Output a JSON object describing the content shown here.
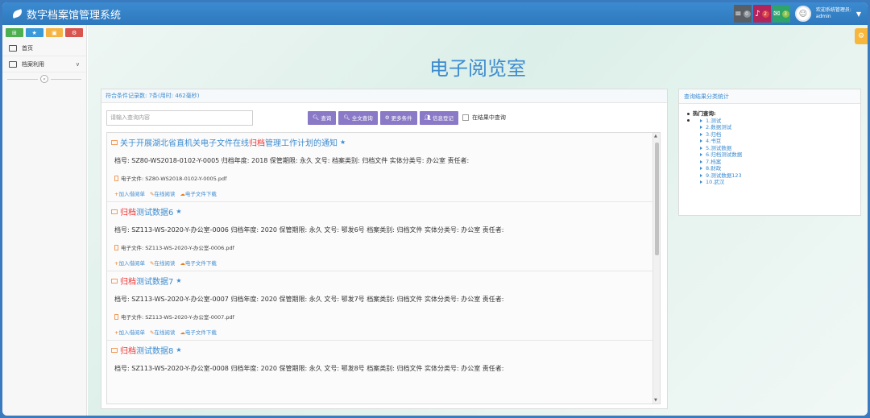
{
  "app": {
    "title": "数字档案馆管理系统"
  },
  "header": {
    "buttons": [
      {
        "icon": "list-icon",
        "count": "0",
        "bg": "#5a5f66",
        "badge": "#8f969e"
      },
      {
        "icon": "bell-icon",
        "count": "2",
        "bg": "#b3245b",
        "badge": "#e04848"
      },
      {
        "icon": "envelope-icon",
        "count": "3",
        "bg": "#2ea36a",
        "badge": "#8bc34a"
      }
    ],
    "user_greeting": "欢迎系统管理员:",
    "user_name": "admin"
  },
  "sidebar": {
    "shortcuts": [
      {
        "icon": "cart-icon",
        "color": "#4caf50"
      },
      {
        "icon": "star-icon",
        "color": "#3a9ad9"
      },
      {
        "icon": "bag-icon",
        "color": "#f4b342"
      },
      {
        "icon": "gears-icon",
        "color": "#d9534f"
      }
    ],
    "items": [
      {
        "label": "首页",
        "icon": "monitor-icon"
      },
      {
        "label": "档案利用",
        "icon": "edit-icon"
      }
    ]
  },
  "main": {
    "page_title": "电子阅览室"
  },
  "results": {
    "stat_text": "符合条件记录数: 7条(用时: 462毫秒)",
    "search_placeholder": "请输入查询内容",
    "buttons": [
      {
        "label": "查询",
        "icon": "search-icon"
      },
      {
        "label": "全文查询",
        "icon": "search-icon"
      },
      {
        "label": "更多条件",
        "icon": "gear-icon"
      },
      {
        "label": "信息登记",
        "icon": "users-icon"
      }
    ],
    "in_results_label": "在结果中查询",
    "action_labels": [
      "加入借阅单",
      "在线阅读",
      "电子文件下载"
    ],
    "items": [
      {
        "title_pre": "关于开展湖北省直机关电子文件在线",
        "title_hl": "归档",
        "title_post": "管理工作计划的通知",
        "meta": "档号: SZ80-WS2018-0102-Y-0005   归档年度: 2018   保管期限: 永久  文号:    档案类别: 归档文件  实体分类号: 办公室  责任者:",
        "file": "电子文件: SZ80-WS2018-0102-Y-0005.pdf"
      },
      {
        "title_pre": "",
        "title_hl": "归档",
        "title_post": "测试数据6",
        "meta": "档号: SZ113-WS-2020-Y-办公室-0006   归档年度: 2020   保管期限: 永久  文号: 鄂发6号  档案类别: 归档文件  实体分类号: 办公室  责任者:",
        "file": "电子文件: SZ113-WS-2020-Y-办公室-0006.pdf"
      },
      {
        "title_pre": "",
        "title_hl": "归档",
        "title_post": "测试数据7",
        "meta": "档号: SZ113-WS-2020-Y-办公室-0007   归档年度: 2020   保管期限: 永久  文号: 鄂发7号  档案类别: 归档文件  实体分类号: 办公室  责任者:",
        "file": "电子文件: SZ113-WS-2020-Y-办公室-0007.pdf"
      },
      {
        "title_pre": "",
        "title_hl": "归档",
        "title_post": "测试数据8",
        "meta": "档号: SZ113-WS-2020-Y-办公室-0008   归档年度: 2020   保管期限: 永久  文号: 鄂发8号  档案类别: 归档文件  实体分类号: 办公室  责任者:",
        "file": ""
      }
    ]
  },
  "stats_panel": {
    "title": "查询结果分类统计",
    "root": "热门查询:",
    "categories": [
      "1.测试",
      "2.数据测试",
      "3.归档",
      "4.书豆",
      "5.测试数据",
      "6.归档测试数据",
      "7.档案",
      "8.财政",
      "9.测试数据123",
      "10.武汉"
    ]
  }
}
